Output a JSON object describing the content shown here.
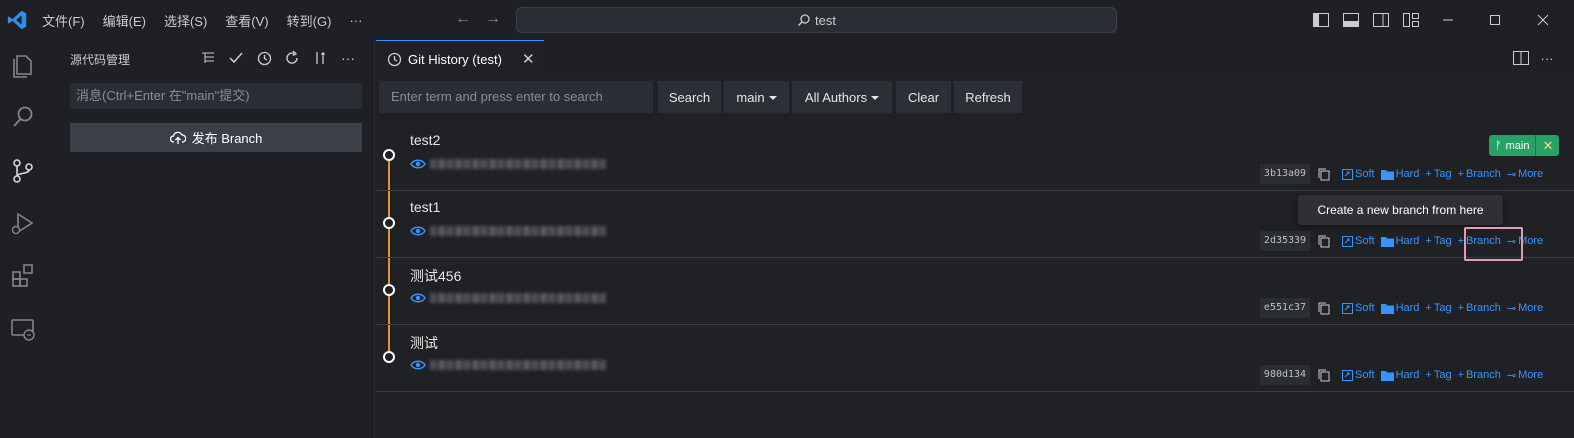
{
  "titlebar": {
    "menu": [
      "文件(F)",
      "编辑(E)",
      "选择(S)",
      "查看(V)",
      "转到(G)",
      "···"
    ],
    "command_center": "test"
  },
  "sidebar": {
    "title": "源代码管理",
    "commit_placeholder": "消息(Ctrl+Enter 在\"main\"提交)",
    "publish_label": "发布 Branch"
  },
  "editor": {
    "tab_title": "Git History (test)",
    "toolbar": {
      "search_placeholder": "Enter term and press enter to search",
      "search_label": "Search",
      "branch_label": "main",
      "authors_label": "All Authors",
      "clear_label": "Clear",
      "refresh_label": "Refresh"
    },
    "branch_badge": "main",
    "tooltip": "Create a new branch from here",
    "actions": {
      "soft": "Soft",
      "hard": "Hard",
      "tag": "Tag",
      "branch": "Branch",
      "more": "More"
    },
    "commits": [
      {
        "message": "test2",
        "sha": "3b13a09"
      },
      {
        "message": "test1",
        "sha": "2d35339"
      },
      {
        "message": "测试456",
        "sha": "e551c37"
      },
      {
        "message": "测试",
        "sha": "980d134"
      }
    ]
  },
  "colors": {
    "accent": "#3794ff",
    "graph": "#ec8e2a",
    "branch_badge": "#27a266",
    "highlight": "#e59ab4"
  }
}
